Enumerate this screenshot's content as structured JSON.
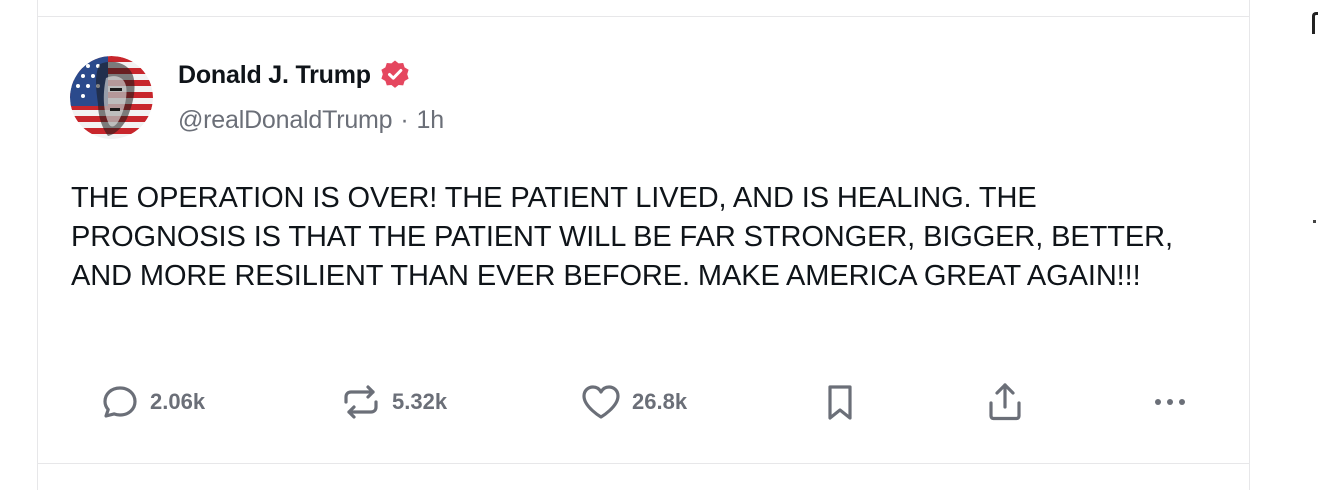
{
  "post": {
    "author": {
      "display_name": "Donald J. Trump",
      "handle": "@realDonaldTrump",
      "separator": "·",
      "time": "1h",
      "verified_icon": "verified-badge-icon",
      "avatar_icon": "profile-avatar"
    },
    "text": "THE OPERATION IS OVER! THE PATIENT LIVED, AND IS HEALING. THE PROGNOSIS IS THAT THE PATIENT WILL BE FAR STRONGER, BIGGER, BETTER, AND MORE RESILIENT THAN EVER BEFORE. MAKE AMERICA GREAT AGAIN!!!",
    "actions": {
      "reply": {
        "icon": "reply-icon",
        "count": "2.06k"
      },
      "repost": {
        "icon": "repost-icon",
        "count": "5.32k"
      },
      "like": {
        "icon": "heart-icon",
        "count": "26.8k"
      },
      "bookmark": {
        "icon": "bookmark-icon"
      },
      "share": {
        "icon": "share-icon"
      },
      "more": {
        "icon": "more-icon"
      }
    }
  },
  "colors": {
    "text_primary": "#0f1419",
    "text_secondary": "#6b6f78",
    "verified_badge": "#e5475f",
    "border": "#e7e7e9"
  }
}
